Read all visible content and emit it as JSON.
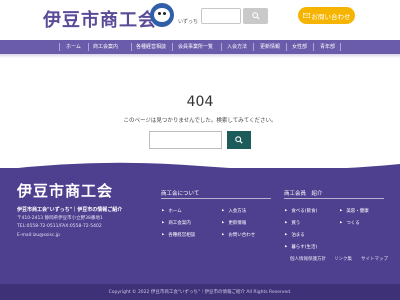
{
  "header": {
    "logo": "伊豆市商工会",
    "mascot_label": "いずっち",
    "search_placeholder": "",
    "contact_label": "お問い合わせ"
  },
  "nav": {
    "items": [
      "ホーム",
      "商工会案内",
      "各種経営相談",
      "会員事業所一覧",
      "入会方法",
      "更新情報",
      "女性部",
      "青年部"
    ]
  },
  "main": {
    "error_code": "404",
    "error_message": "このページは見つかりませんでした。検索してみてください。",
    "search_placeholder": ""
  },
  "footer": {
    "logo": "伊豆市商工会",
    "description": "伊豆市商工会\"いずっち\"｜伊豆市の情報ご紹介",
    "address": "〒410-2413 静岡県伊豆市小立野38番地1",
    "phone": "TEL:0558-72-0511/FAX:0558-72-5402",
    "email": "E-mail:izu@ssisc.jp",
    "about_heading": "商工会について",
    "about_links": [
      "ホーム",
      "商工会案内",
      "各種経営相談",
      "入会方法",
      "更新情報",
      "お問い合わせ"
    ],
    "members_heading": "商工会員　紹介",
    "members_links": [
      "食べる(飲食)",
      "買う",
      "泊まる",
      "美容・健康",
      "つくる",
      "暮らす(生活)"
    ],
    "bottom_links": [
      "個人情報保護方針",
      "リンク集",
      "サイトマップ"
    ],
    "copyright": "Copyright © 2022 伊豆市商工会\"いずっち\"｜伊豆市の情報ご紹介 All Rights Reserved."
  },
  "colors": {
    "brand_purple": "#6b5bab",
    "footer_purple": "#4f3f8f",
    "accent_yellow": "#f5b400",
    "search_button_dark": "#1e5b5b"
  }
}
